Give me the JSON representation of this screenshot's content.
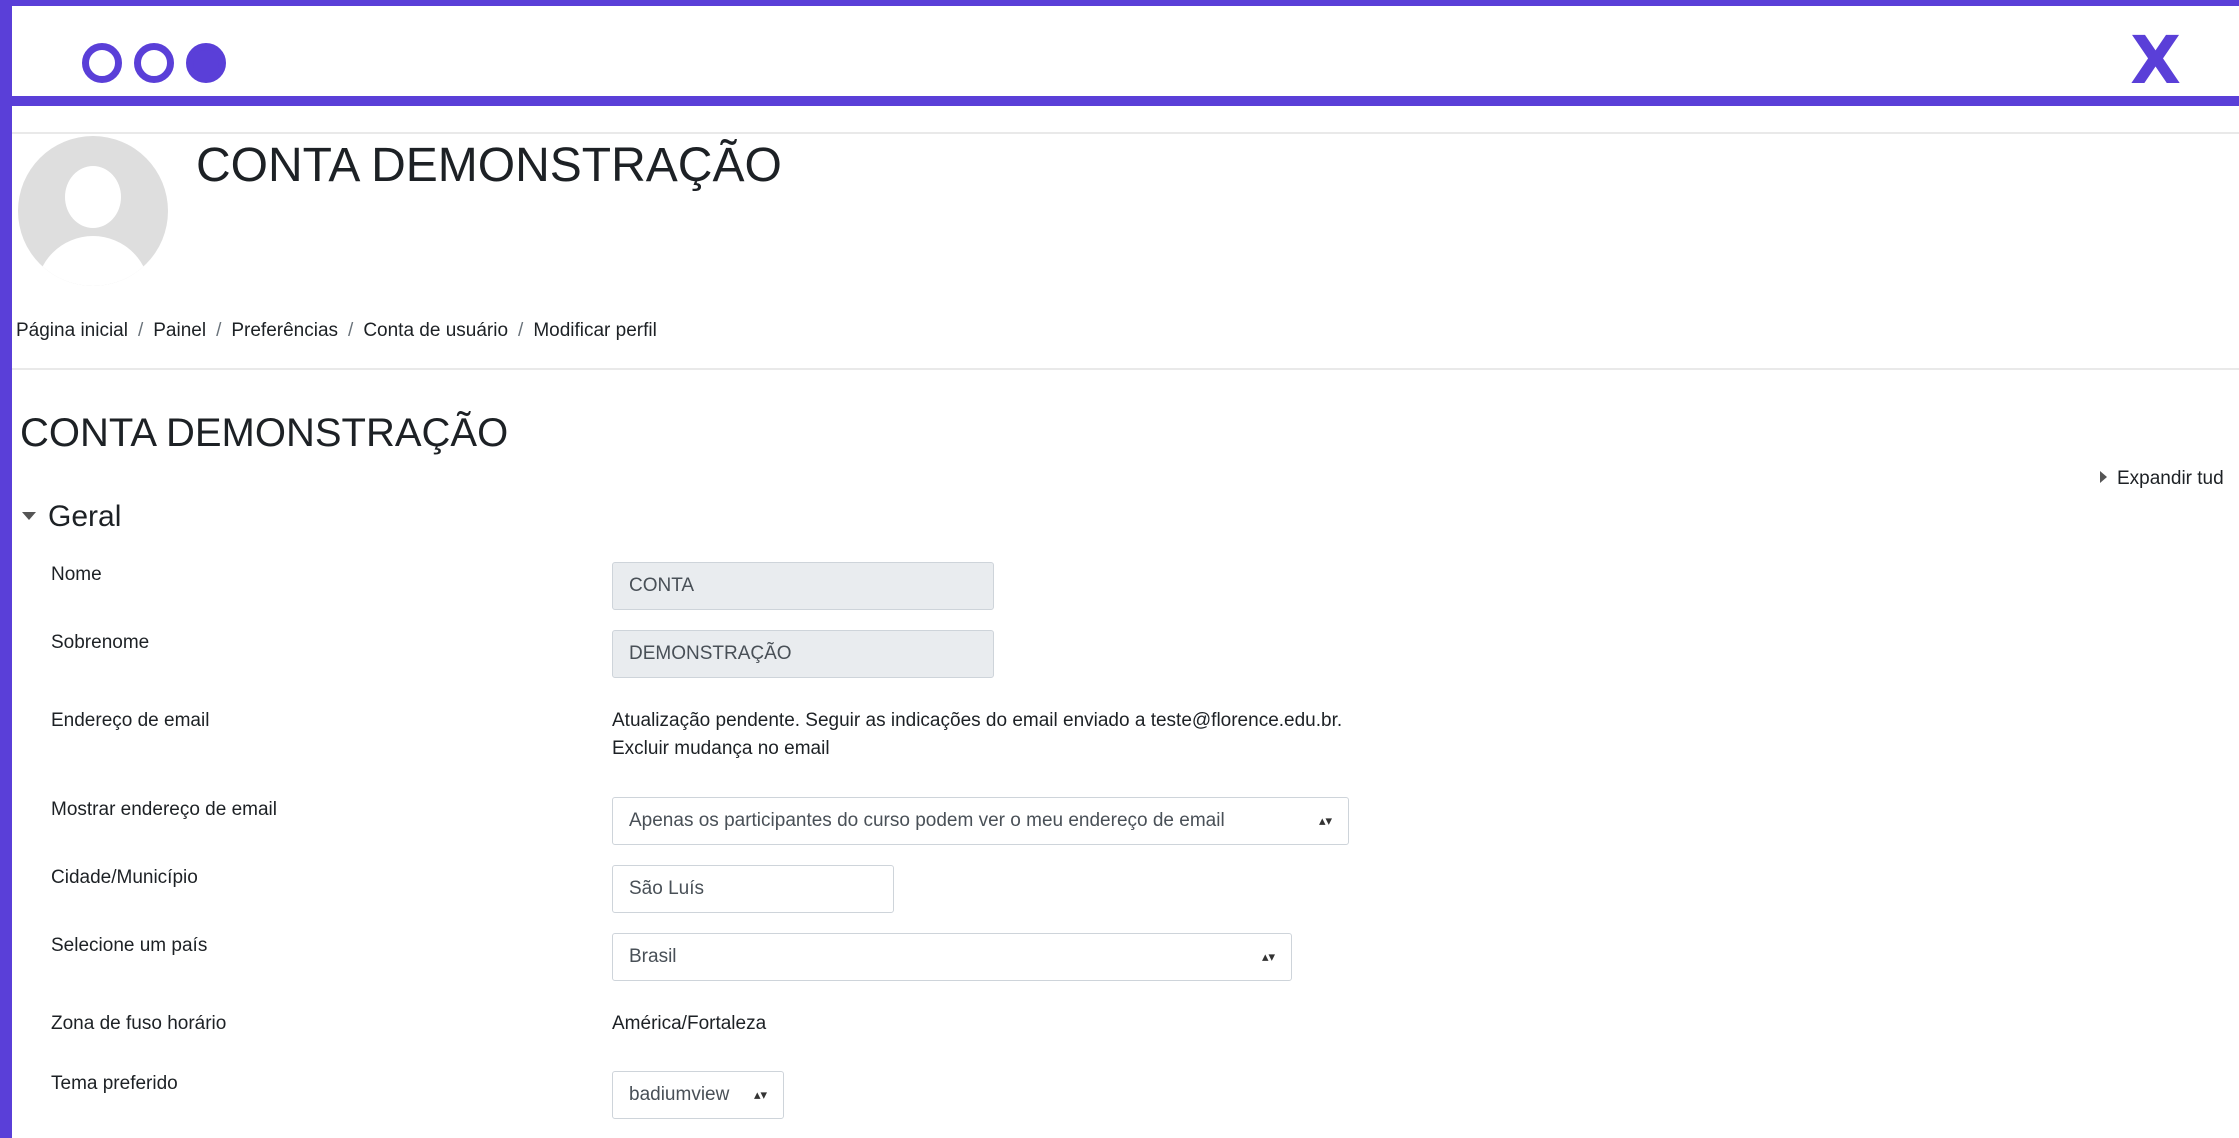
{
  "window": {
    "controls": [
      "circle-outline-icon",
      "circle-outline-icon",
      "circle-filled-icon"
    ],
    "close_label": "X",
    "accent_color": "#5a3fd8"
  },
  "header": {
    "title": "CONTA DEMONSTRAÇÃO",
    "avatar_icon": "default-user-avatar-icon"
  },
  "breadcrumb": [
    "Página inicial",
    "Painel",
    "Preferências",
    "Conta de usuário",
    "Modificar perfil"
  ],
  "breadcrumb_separator": "/",
  "section": {
    "title": "CONTA DEMONSTRAÇÃO",
    "expand_label": "Expandir tud"
  },
  "fieldset": {
    "legend": "Geral"
  },
  "form": {
    "nome": {
      "label": "Nome",
      "value": "CONTA"
    },
    "sobrenome": {
      "label": "Sobrenome",
      "value": "DEMONSTRAÇÃO"
    },
    "email": {
      "label": "Endereço de email",
      "pending_text": "Atualização pendente. Seguir as indicações do email enviado a teste@florence.edu.br.",
      "cancel_link": "Excluir mudança no email"
    },
    "show_email": {
      "label": "Mostrar endereço de email",
      "value": "Apenas os participantes do curso podem ver o meu endereço de email"
    },
    "city": {
      "label": "Cidade/Município",
      "value": "São Luís"
    },
    "country": {
      "label": "Selecione um país",
      "value": "Brasil"
    },
    "timezone": {
      "label": "Zona de fuso horário",
      "value": "América/Fortaleza"
    },
    "theme": {
      "label": "Tema preferido",
      "value": "badiumview"
    }
  }
}
